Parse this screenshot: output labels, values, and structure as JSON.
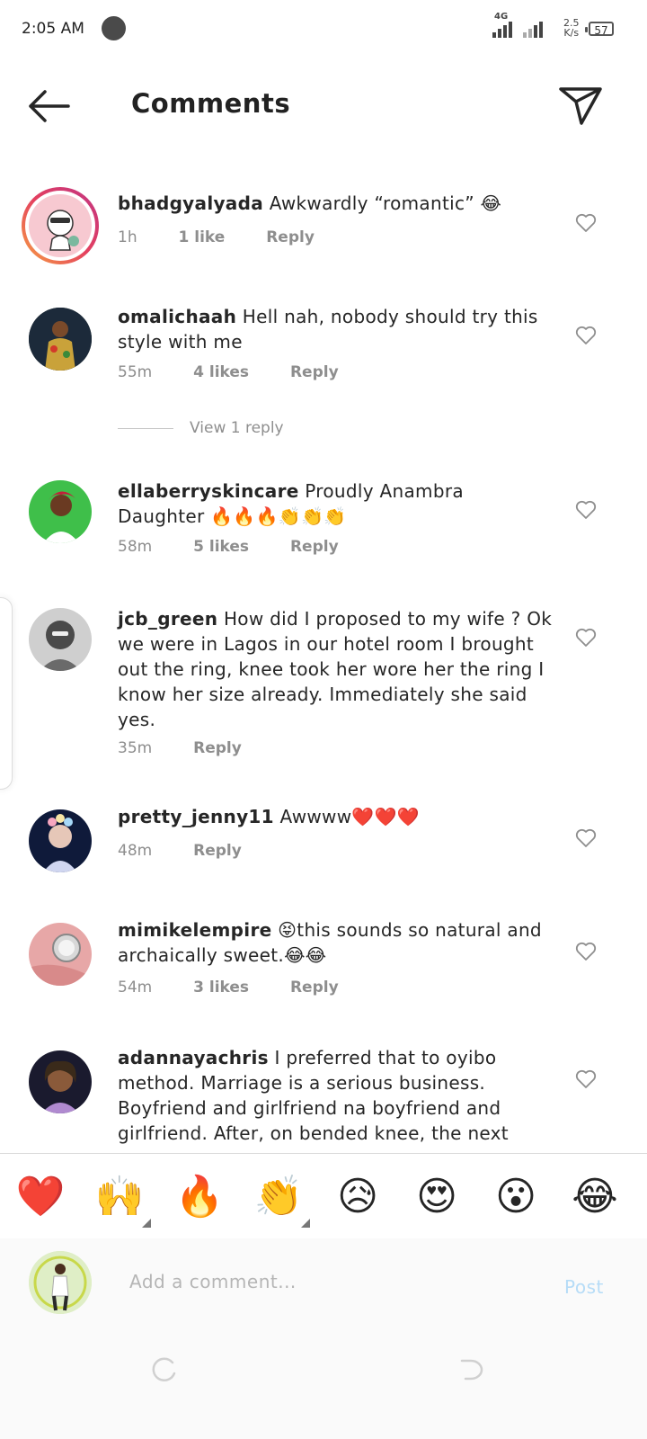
{
  "status_bar": {
    "time": "2:05 AM",
    "network": "4G",
    "speed_value": "2.5",
    "speed_unit": "K/s",
    "battery": "57"
  },
  "header": {
    "title": "Comments",
    "back_icon": "arrow-left-icon",
    "share_icon": "send-icon"
  },
  "comments": [
    {
      "user": "bhadgyalyada",
      "text": "Awkwardly “romantic” 😂",
      "time": "1h",
      "likes": "1 like",
      "reply": "Reply"
    },
    {
      "user": "omalichaah",
      "text": "Hell nah, nobody should try this style with me",
      "time": "55m",
      "likes": "4 likes",
      "reply": "Reply",
      "view_replies": "View 1 reply"
    },
    {
      "user": "ellaberryskincare",
      "text": "Proudly Anambra Daughter 🔥🔥🔥👏👏👏",
      "time": "58m",
      "likes": "5 likes",
      "reply": "Reply"
    },
    {
      "user": "jcb_green",
      "text": "How did I proposed to my wife ? Ok we were in Lagos in our hotel room I brought out the ring, knee took her wore her the ring I know her size already. Immediately she said yes.",
      "time": "35m",
      "reply": "Reply"
    },
    {
      "user": "pretty_jenny11",
      "text": "Awwww❤️❤️❤️",
      "time": "48m",
      "reply": "Reply"
    },
    {
      "user": "mimikelempire",
      "text": "😝this sounds so natural and archaically sweet.😂😂",
      "time": "54m",
      "likes": "3 likes",
      "reply": "Reply"
    },
    {
      "user": "adannayachris",
      "text": "I preferred that to oyibo method. Marriage is a serious business. Boyfriend and girlfriend na boyfriend and girlfriend. After, on bended knee, the next"
    }
  ],
  "quick_reactions": [
    "❤️",
    "🙌",
    "🔥",
    "👏",
    "😥",
    "😍",
    "😮",
    "😂"
  ],
  "composer": {
    "placeholder": "Add a comment...",
    "post_label": "Post"
  },
  "colors": {
    "text": "#262626",
    "meta": "#8e8e8e",
    "post_disabled": "#b6dcf7",
    "story_ring": "#e4405f"
  }
}
